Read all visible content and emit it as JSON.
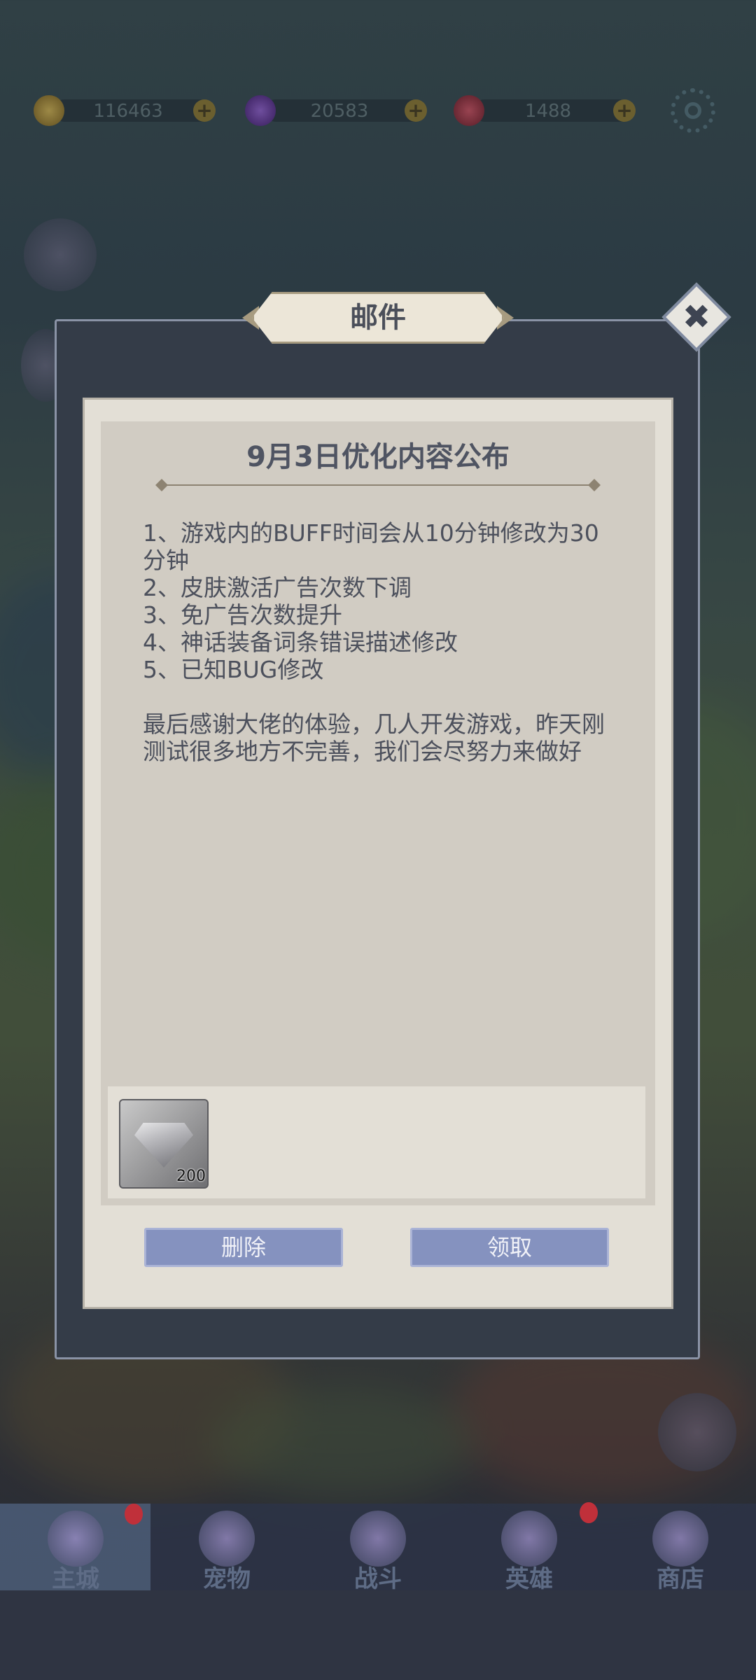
{
  "resources": [
    {
      "name": "gold",
      "value": "116463",
      "color": "#c9a63a"
    },
    {
      "name": "purple-gem",
      "value": "20583",
      "color": "#7e3fc4"
    },
    {
      "name": "ruby",
      "value": "1488",
      "color": "#c23a4a"
    }
  ],
  "modal": {
    "title": "邮件",
    "close_icon": "close-icon",
    "mail_title": "9月3日优化内容公布",
    "body": "1、游戏内的BUFF时间会从10分钟修改为30分钟\n2、皮肤激活广告次数下调\n3、免广告次数提升\n4、神话装备词条错误描述修改\n5、已知BUG修改\n\n最后感谢大佬的体验，几人开发游戏，昨天刚测试很多地方不完善，我们会尽努力来做好",
    "reward": {
      "icon": "diamond-icon",
      "count": "200"
    },
    "buttons": {
      "delete": "删除",
      "claim": "领取"
    }
  },
  "nav": [
    {
      "label": "主城",
      "icon": "castle-icon",
      "badge": true,
      "active": true
    },
    {
      "label": "宠物",
      "icon": "pet-icon",
      "badge": false
    },
    {
      "label": "战斗",
      "icon": "battle-icon",
      "badge": false
    },
    {
      "label": "英雄",
      "icon": "hero-icon",
      "badge": true
    },
    {
      "label": "商店",
      "icon": "shop-icon",
      "badge": false
    }
  ]
}
